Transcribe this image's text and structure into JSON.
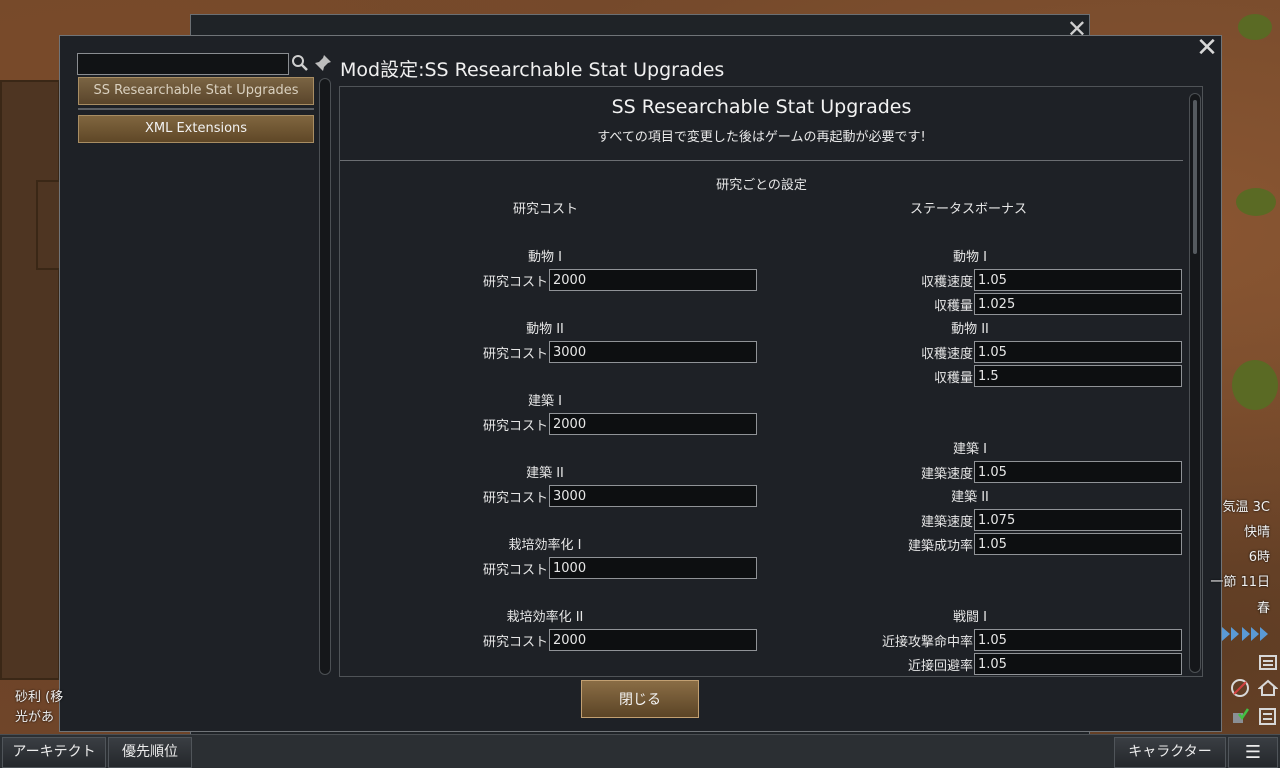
{
  "dialog": {
    "title": "Mod設定:SS Researchable Stat Upgrades",
    "close_glyph": "✕",
    "search_placeholder": "",
    "search_value": ""
  },
  "mods": [
    {
      "label": "SS Researchable Stat Upgrades",
      "selected": true
    },
    {
      "label": "XML Extensions",
      "selected": false
    }
  ],
  "settings": {
    "heading": "SS Researchable Stat Upgrades",
    "warning": "すべての項目で変更した後はゲームの再起動が必要です!",
    "section_title": "研究ごとの設定",
    "left_column_title": "研究コスト",
    "right_column_title": "ステータスボーナス",
    "research_costs": [
      {
        "group": "動物 I",
        "label": "研究コスト",
        "value": "2000"
      },
      {
        "group": "動物 II",
        "label": "研究コスト",
        "value": "3000"
      },
      {
        "group": "建築 I",
        "label": "研究コスト",
        "value": "2000"
      },
      {
        "group": "建築 II",
        "label": "研究コスト",
        "value": "3000"
      },
      {
        "group": "栽培効率化 I",
        "label": "研究コスト",
        "value": "1000"
      },
      {
        "group": "栽培効率化 II",
        "label": "研究コスト",
        "value": "2000"
      }
    ],
    "stat_bonuses": [
      {
        "group": "動物 I",
        "fields": [
          {
            "label": "収穫速度",
            "value": "1.05"
          },
          {
            "label": "収穫量",
            "value": "1.025"
          }
        ]
      },
      {
        "group": "動物 II",
        "fields": [
          {
            "label": "収穫速度",
            "value": "1.05"
          },
          {
            "label": "収穫量",
            "value": "1.5"
          }
        ]
      },
      {
        "group": "建築 I",
        "fields": [
          {
            "label": "建築速度",
            "value": "1.05"
          }
        ]
      },
      {
        "group": "建築 II",
        "fields": [
          {
            "label": "建築速度",
            "value": "1.075"
          },
          {
            "label": "建築成功率",
            "value": "1.05"
          }
        ]
      },
      {
        "group": "戦闘 I",
        "fields": [
          {
            "label": "近接攻撃命中率",
            "value": "1.05"
          },
          {
            "label": "近接回避率",
            "value": "1.05"
          }
        ]
      }
    ],
    "close_button": "閉じる"
  },
  "bottom_bar": {
    "architect": "アーキテクト",
    "priority": "優先順位",
    "character": "キャラクター",
    "menu_glyph": "☰"
  },
  "hud": {
    "temperature": "気温 3C",
    "weather": "快晴",
    "hour": "6時",
    "date": "一節 11日",
    "season": "春"
  },
  "info": {
    "line1": "砂利 (移",
    "line2": "光があ"
  }
}
